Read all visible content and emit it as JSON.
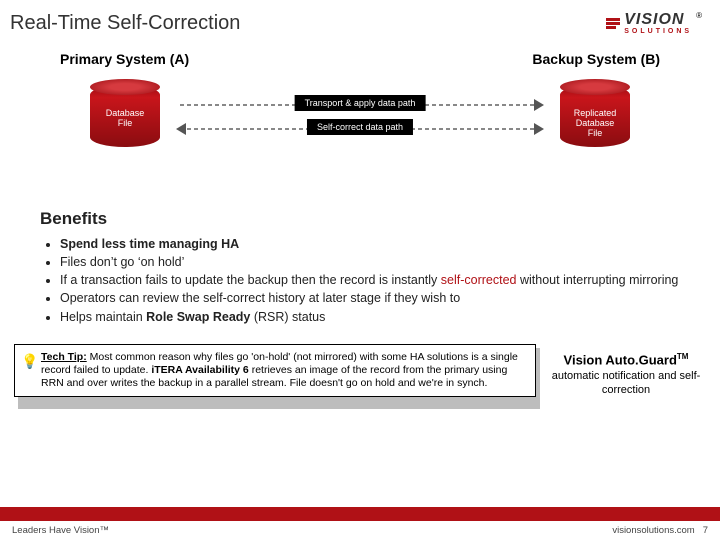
{
  "header": {
    "title": "Real-Time Self-Correction",
    "logo_main": "VISION",
    "logo_sub": "SOLUTIONS",
    "logo_reg": "®"
  },
  "diagram": {
    "primary_label": "Primary System (A)",
    "backup_label": "Backup System (B)",
    "cyl_a": "Database\nFile",
    "cyl_b": "Replicated\nDatabase\nFile",
    "arrow_top": "Transport & apply data path",
    "arrow_bottom": "Self-correct data path"
  },
  "benefits": {
    "heading": "Benefits",
    "items": [
      {
        "pre": "",
        "bold": "Spend less time managing HA",
        "post": ""
      },
      {
        "pre": "Files don’t go ‘on hold’",
        "bold": "",
        "post": ""
      },
      {
        "pre": "If a transaction fails to update the backup then the record is instantly ",
        "red": "self-corrected",
        "post": " without interrupting mirroring"
      },
      {
        "pre": "Operators can review the self-correct history at later stage if they wish to",
        "bold": "",
        "post": ""
      },
      {
        "pre": "Helps maintain ",
        "bold": "Role Swap Ready",
        "post": " (RSR) status"
      }
    ]
  },
  "tip": {
    "label": "Tech Tip:",
    "body_a": " Most common reason why files go 'on-hold' (not mirrored) with some HA solutions is a single record failed to update. ",
    "body_bold": "iTERA Availability 6",
    "body_b": " retrieves an image of the record from the primary using RRN and over writes the backup in a parallel stream. File doesn't go on hold and we're in synch."
  },
  "sidebox": {
    "title_a": "Vision Auto.Guard",
    "title_sup": "TM",
    "line": "automatic notification and self-correction"
  },
  "footer": {
    "left": "Leaders Have Vision™",
    "site": "visionsolutions.com",
    "page": "7"
  }
}
